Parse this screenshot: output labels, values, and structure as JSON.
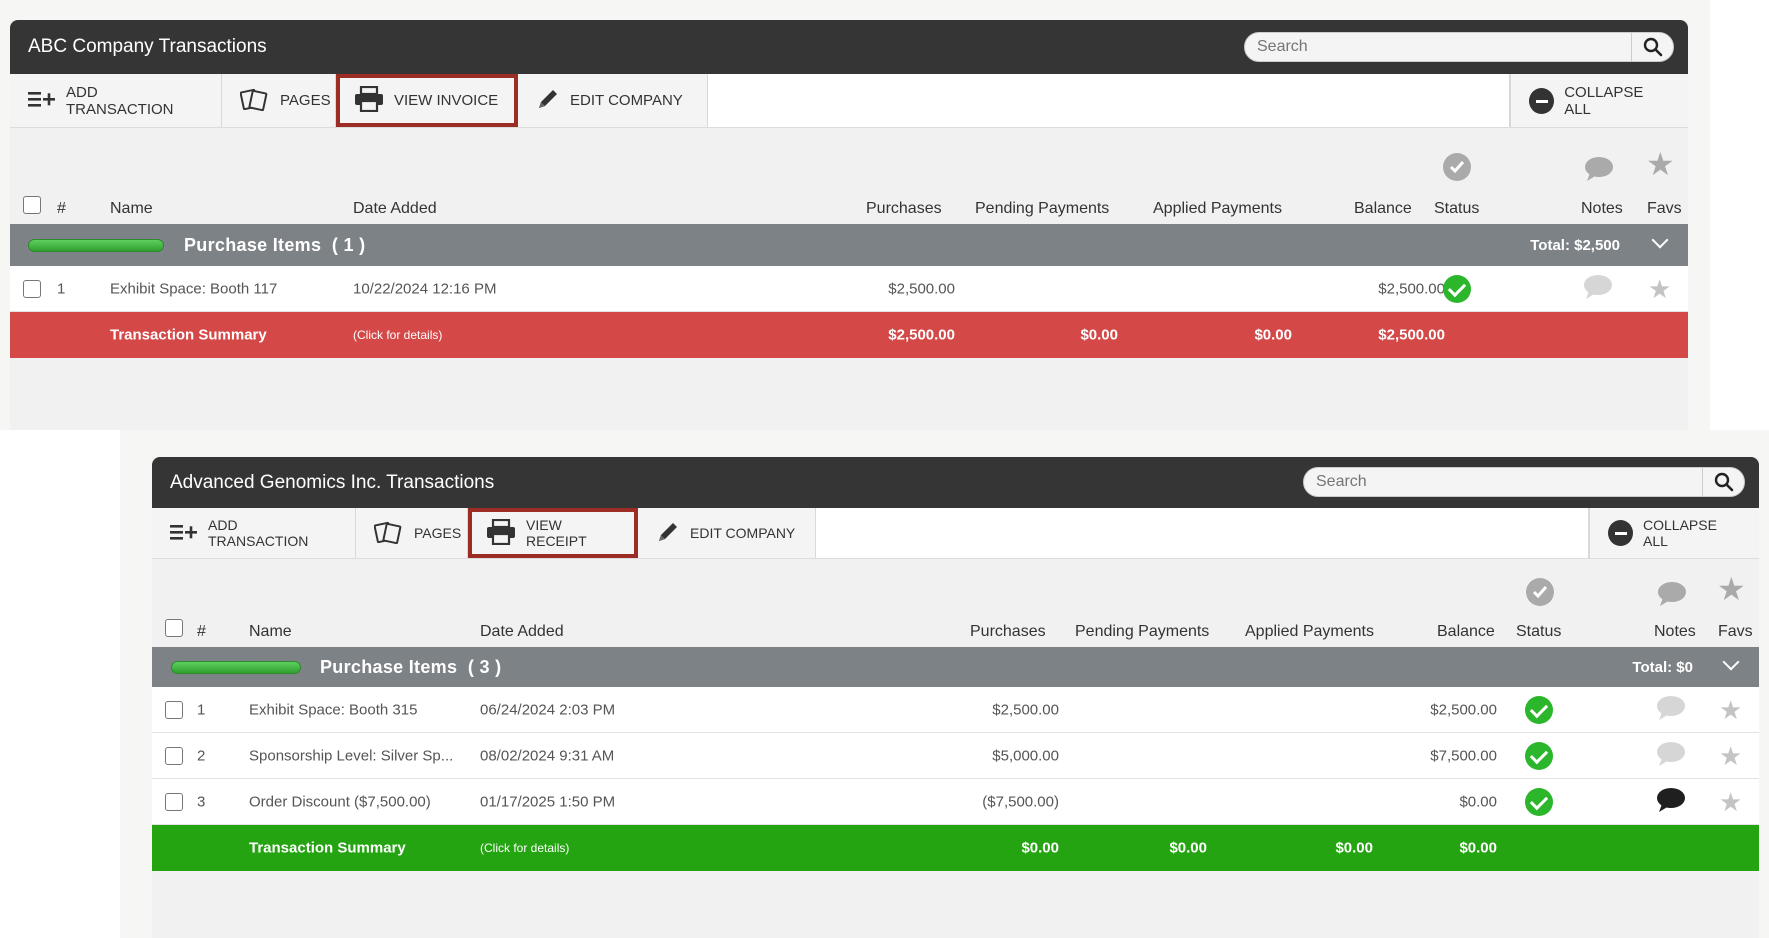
{
  "colors": {
    "titlebar": "#353535",
    "highlight": "#9b2d24",
    "group_bar": "#7d8287",
    "summary_red": "#d44848",
    "summary_green": "#23a410",
    "status_check": "#2bb62b"
  },
  "panels": [
    {
      "title": "ABC Company Transactions",
      "search_placeholder": "Search",
      "toolbar": {
        "add": "ADD TRANSACTION",
        "pages": "PAGES",
        "view": "VIEW INVOICE",
        "edit": "EDIT COMPANY",
        "collapse": "COLLAPSE ALL"
      },
      "columns": {
        "num": "#",
        "name": "Name",
        "date": "Date Added",
        "purchases": "Purchases",
        "pending": "Pending Payments",
        "applied": "Applied Payments",
        "balance": "Balance",
        "status": "Status",
        "notes": "Notes",
        "favs": "Favs"
      },
      "group": {
        "title": "Purchase Items",
        "count": "( 1 )",
        "total": "Total:  $2,500"
      },
      "rows": [
        {
          "num": "1",
          "name": "Exhibit Space: Booth 117",
          "date": "10/22/2024 12:16 PM",
          "purchases": "$2,500.00",
          "balance": "$2,500.00",
          "note": "empty"
        }
      ],
      "summary": {
        "label": "Transaction Summary",
        "hint": "(Click for details)",
        "purchases": "$2,500.00",
        "pending": "$0.00",
        "applied": "$0.00",
        "balance": "$2,500.00"
      }
    },
    {
      "title": "Advanced Genomics Inc. Transactions",
      "search_placeholder": "Search",
      "toolbar": {
        "add": "ADD TRANSACTION",
        "pages": "PAGES",
        "view": "VIEW RECEIPT",
        "edit": "EDIT COMPANY",
        "collapse": "COLLAPSE ALL"
      },
      "columns": {
        "num": "#",
        "name": "Name",
        "date": "Date Added",
        "purchases": "Purchases",
        "pending": "Pending Payments",
        "applied": "Applied Payments",
        "balance": "Balance",
        "status": "Status",
        "notes": "Notes",
        "favs": "Favs"
      },
      "group": {
        "title": "Purchase Items",
        "count": "( 3 )",
        "total": "Total:  $0"
      },
      "rows": [
        {
          "num": "1",
          "name": "Exhibit Space: Booth 315",
          "date": "06/24/2024 2:03 PM",
          "purchases": "$2,500.00",
          "balance": "$2,500.00",
          "note": "empty"
        },
        {
          "num": "2",
          "name": "Sponsorship Level: Silver Sp...",
          "date": "08/02/2024 9:31 AM",
          "purchases": "$5,000.00",
          "balance": "$7,500.00",
          "note": "empty"
        },
        {
          "num": "3",
          "name": "Order Discount ($7,500.00)",
          "date": "01/17/2025 1:50 PM",
          "purchases": "($7,500.00)",
          "balance": "$0.00",
          "note": "filled"
        }
      ],
      "summary": {
        "label": "Transaction Summary",
        "hint": "(Click for details)",
        "purchases": "$0.00",
        "pending": "$0.00",
        "applied": "$0.00",
        "balance": "$0.00"
      }
    }
  ]
}
